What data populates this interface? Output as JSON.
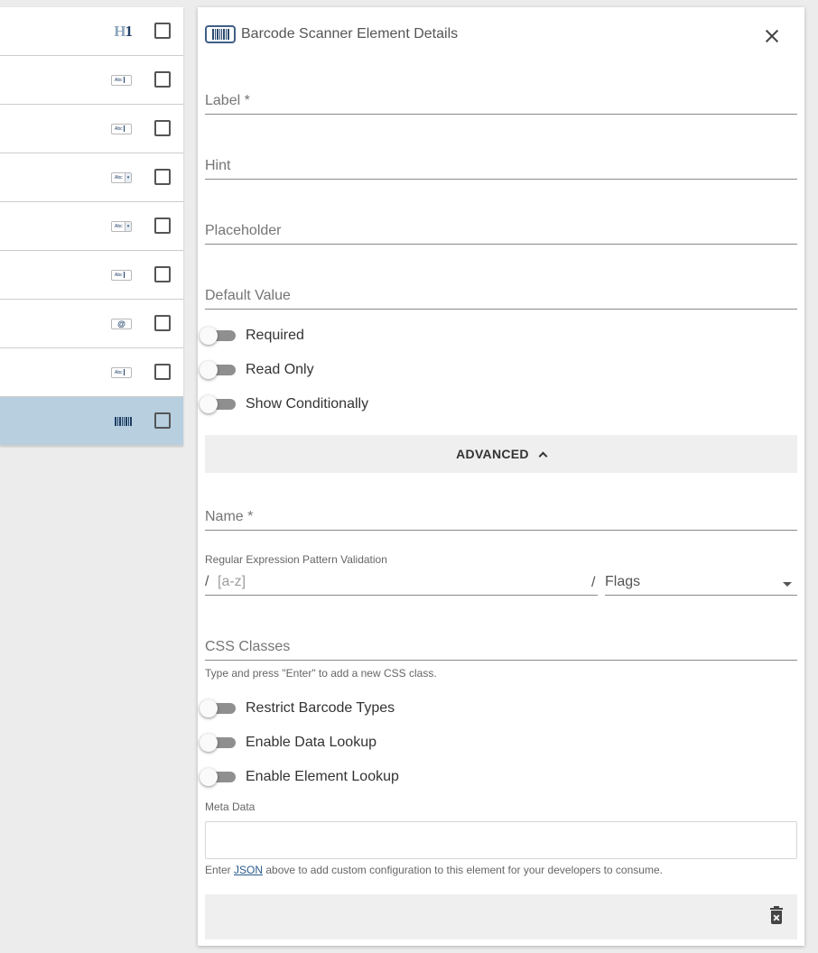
{
  "left_list": {
    "items": [
      {
        "icon": "heading-icon",
        "icon_text": "H1",
        "selected": false
      },
      {
        "icon": "text-input-icon",
        "icon_text": "Abc",
        "selected": false
      },
      {
        "icon": "text-input-icon",
        "icon_text": "Abc",
        "selected": false
      },
      {
        "icon": "select-icon",
        "icon_text": "Abc",
        "selected": false
      },
      {
        "icon": "select-icon",
        "icon_text": "Abc",
        "selected": false
      },
      {
        "icon": "text-input-icon",
        "icon_text": "Abc",
        "selected": false
      },
      {
        "icon": "email-icon",
        "icon_text": "@",
        "selected": false
      },
      {
        "icon": "text-input-icon",
        "icon_text": "Abc",
        "selected": false
      },
      {
        "icon": "barcode-icon",
        "icon_text": "",
        "selected": true
      }
    ]
  },
  "panel": {
    "title": "Barcode Scanner Element Details",
    "fields": {
      "label": "Label *",
      "hint": "Hint",
      "placeholder": "Placeholder",
      "default_value": "Default Value"
    },
    "toggles": {
      "required": "Required",
      "read_only": "Read Only",
      "show_conditionally": "Show Conditionally"
    },
    "advanced_label": "ADVANCED",
    "advanced": {
      "name": "Name *",
      "regex_label": "Regular Expression Pattern Validation",
      "regex_slash": "/",
      "regex_placeholder": "[a-z]",
      "flags": "Flags",
      "css_classes": "CSS Classes",
      "css_help": "Type and press \"Enter\" to add a new CSS class.",
      "restrict_barcode_types": "Restrict Barcode Types",
      "enable_data_lookup": "Enable Data Lookup",
      "enable_element_lookup": "Enable Element Lookup",
      "meta_data_label": "Meta Data",
      "meta_help_prefix": "Enter ",
      "meta_help_link": "JSON",
      "meta_help_suffix": " above to add custom configuration to this element for your developers to consume."
    }
  }
}
